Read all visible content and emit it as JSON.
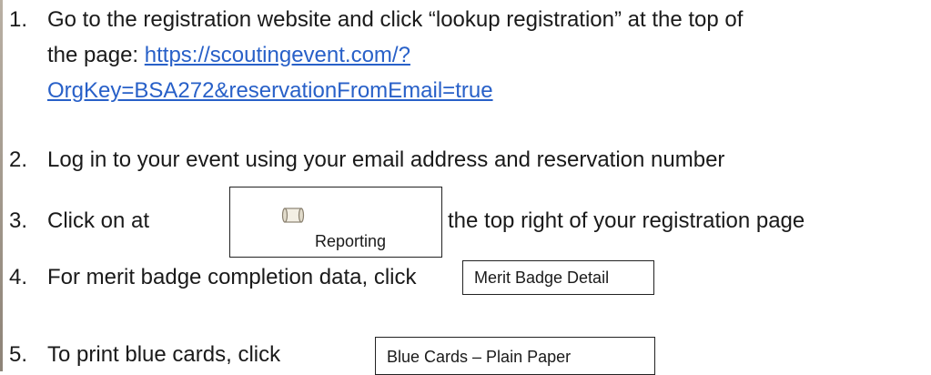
{
  "steps": [
    {
      "number": "1.",
      "text_line1": "Go to the registration website and click “lookup registration” at the top of",
      "text_line2_prefix": "the page: ",
      "link_part1": "https://scoutingevent.com/?",
      "link_part2": "OrgKey=BSA272&reservationFromEmail=true"
    },
    {
      "number": "2.",
      "text": "Log in to your event using your email address and reservation number"
    },
    {
      "number": "3.",
      "text_before": "Click on at",
      "button_label": "Reporting",
      "button_icon": "scroll-icon",
      "text_after": "the top right of your registration page"
    },
    {
      "number": "4.",
      "text": "For merit badge completion data, click",
      "button_label": "Merit Badge Detail"
    },
    {
      "number": "5.",
      "text": "To print blue cards, click",
      "button_label": "Blue Cards – Plain Paper"
    }
  ],
  "colors": {
    "link": "#2860c8",
    "text": "#1a1a1a",
    "border": "#222222"
  }
}
